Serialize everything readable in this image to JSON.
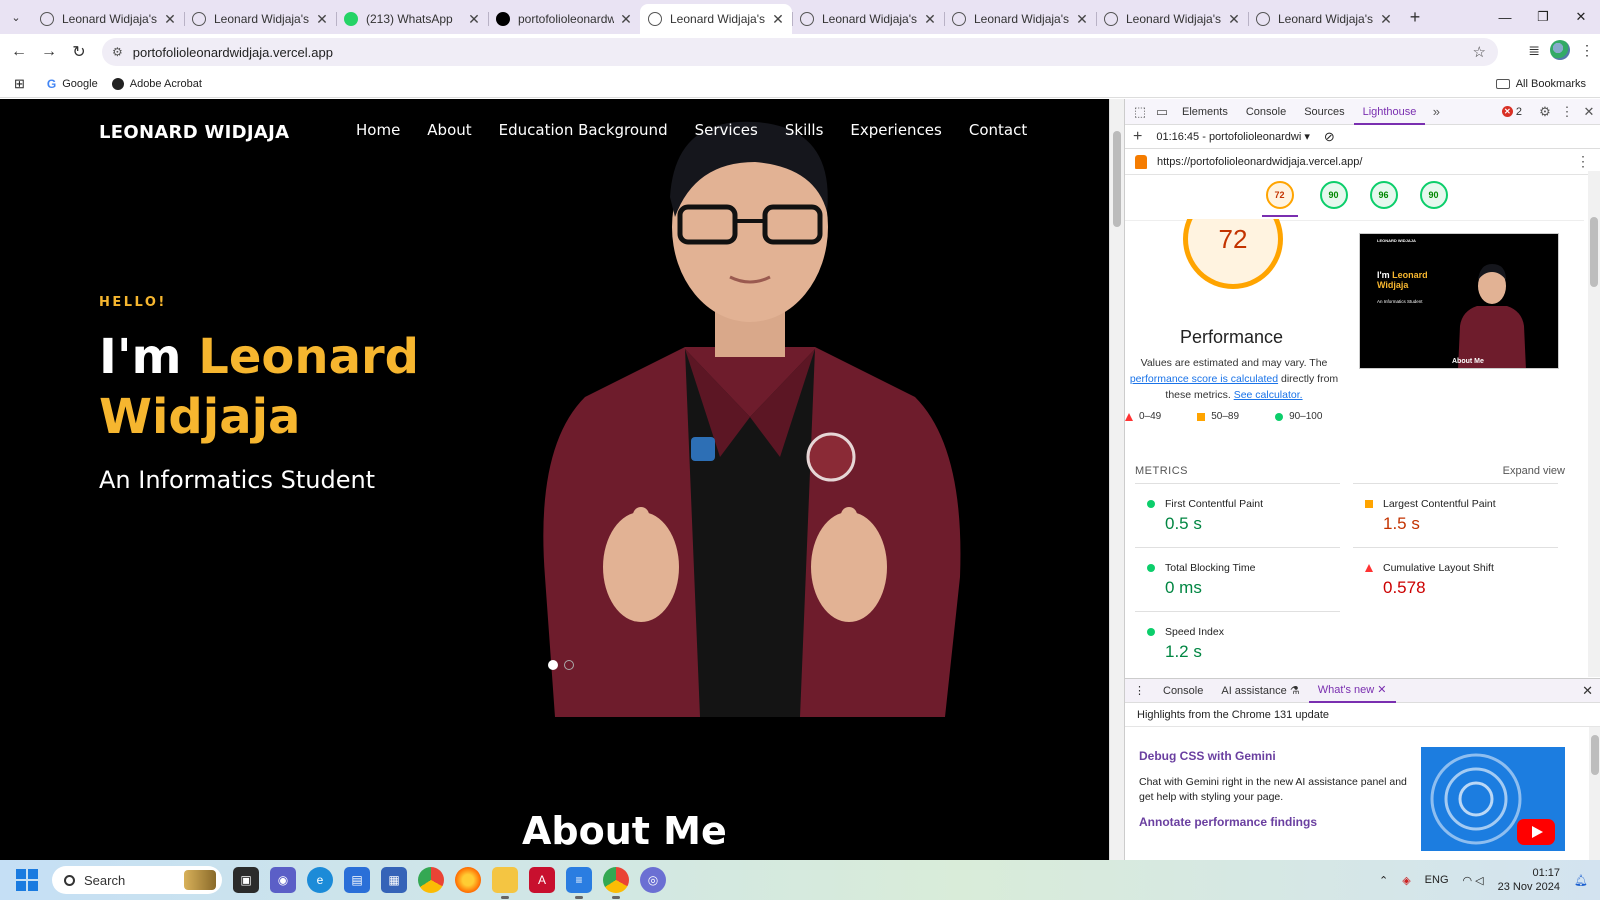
{
  "browser": {
    "tabs": [
      {
        "title": "Leonard Widjaja's Por",
        "icon": "globe-icon",
        "active": false
      },
      {
        "title": "Leonard Widjaja's Por",
        "icon": "globe-icon",
        "active": false
      },
      {
        "title": "(213) WhatsApp",
        "icon": "whatsapp-icon",
        "active": false
      },
      {
        "title": "portofolioleonardwid",
        "icon": "vercel-icon",
        "active": false
      },
      {
        "title": "Leonard Widjaja's Por",
        "icon": "globe-icon",
        "active": true
      },
      {
        "title": "Leonard Widjaja's Por",
        "icon": "globe-icon",
        "active": false
      },
      {
        "title": "Leonard Widjaja's Por",
        "icon": "globe-icon",
        "active": false
      },
      {
        "title": "Leonard Widjaja's Por",
        "icon": "globe-icon",
        "active": false
      },
      {
        "title": "Leonard Widjaja's Por",
        "icon": "globe-icon",
        "active": false
      }
    ],
    "url": "portofolioleonardwidjaja.vercel.app",
    "bookmarks": {
      "google": "Google",
      "acrobat": "Adobe Acrobat",
      "all": "All Bookmarks"
    }
  },
  "site": {
    "logo": "LEONARD WIDJAJA",
    "nav": [
      "Home",
      "About",
      "Education Background",
      "Services",
      "Skills",
      "Experiences",
      "Contact"
    ],
    "hello": "HELLO!",
    "title_prefix": "I'm ",
    "title_name_1": "Leonard",
    "title_name_2": "Widjaja",
    "subtitle": "An Informatics Student",
    "about_title": "About Me",
    "slides": 2,
    "active_slide": 1
  },
  "devtools": {
    "tabs": [
      "Elements",
      "Console",
      "Sources",
      "Lighthouse"
    ],
    "active_tab": "Lighthouse",
    "error_count": "2",
    "report_label": "01:16:45 - portofolioleonardwi",
    "report_url": "https://portofolioleonardwidjaja.vercel.app/",
    "scores": [
      "72",
      "90",
      "96",
      "90"
    ],
    "performance_score": "72",
    "performance_title": "Performance",
    "desc_1": "Values are estimated and may vary. The",
    "desc_link_1": "performance score is calculated",
    "desc_2": "directly from these metrics.",
    "desc_link_2": "See calculator.",
    "legend": [
      "0–49",
      "50–89",
      "90–100"
    ],
    "metrics_label": "METRICS",
    "expand_view": "Expand view",
    "metrics": [
      {
        "name": "First Contentful Paint",
        "value": "0.5 s",
        "status": "green"
      },
      {
        "name": "Largest Contentful Paint",
        "value": "1.5 s",
        "status": "orange"
      },
      {
        "name": "Total Blocking Time",
        "value": "0 ms",
        "status": "green"
      },
      {
        "name": "Cumulative Layout Shift",
        "value": "0.578",
        "status": "red"
      },
      {
        "name": "Speed Index",
        "value": "1.2 s",
        "status": "green"
      }
    ],
    "drawer_tabs": [
      "Console",
      "AI assistance",
      "What's new"
    ],
    "whats_new_header": "Highlights from the Chrome 131 update",
    "wn_title_1": "Debug CSS with Gemini",
    "wn_text_1": "Chat with Gemini right in the new AI assistance panel and get help with styling your page.",
    "wn_title_2": "Annotate performance findings"
  },
  "taskbar": {
    "search": "Search",
    "lang": "ENG",
    "time": "01:17",
    "date": "23 Nov 2024"
  },
  "colors": {
    "accent_yellow": "#f6b62f",
    "lighthouse_orange": "#ffa400",
    "lighthouse_green": "#0cce6b"
  }
}
